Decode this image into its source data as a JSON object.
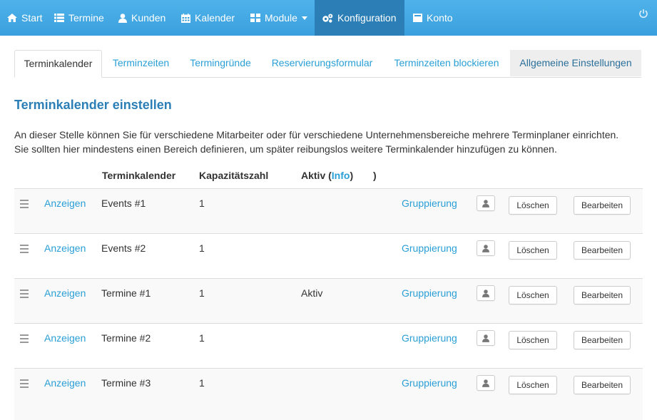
{
  "nav": {
    "items": [
      {
        "label": "Start",
        "icon": "home-icon"
      },
      {
        "label": "Termine",
        "icon": "list-icon"
      },
      {
        "label": "Kunden",
        "icon": "user-icon"
      },
      {
        "label": "Kalender",
        "icon": "calendar-icon"
      },
      {
        "label": "Module",
        "icon": "grid-icon"
      },
      {
        "label": "Konfiguration",
        "icon": "gears-icon"
      },
      {
        "label": "Konto",
        "icon": "account-icon"
      }
    ],
    "active": "Konfiguration",
    "power_icon": "power-icon"
  },
  "tabs": [
    "Terminkalender",
    "Terminzeiten",
    "Termingründe",
    "Reservierungsformular",
    "Terminzeiten blockieren",
    "Allgemeine Einstellungen"
  ],
  "active_tab": "Terminkalender",
  "page": {
    "title": "Terminkalender einstellen",
    "desc_line1": "An dieser Stelle können Sie für verschiedene Mitarbeiter oder für verschiedene Unternehmensbereiche mehrere Terminplaner einrichten.",
    "desc_line2": "Sie sollten hier mindestens einen Bereich definieren, um später reibungslos weitere Terminkalender hinzufügen zu können."
  },
  "table": {
    "headers": {
      "calendar": "Terminkalender",
      "capacity": "Kapazitätszahl",
      "active_prefix": "Aktiv (",
      "active_info": "Info",
      "active_suffix": ")",
      "extra": ")"
    },
    "show_label": "Anzeigen",
    "group_label": "Gruppierung",
    "delete_label": "Löschen",
    "edit_label": "Bearbeiten",
    "rows": [
      {
        "name": "Events #1",
        "capacity": "1",
        "active": ""
      },
      {
        "name": "Events #2",
        "capacity": "1",
        "active": ""
      },
      {
        "name": "Termine #1",
        "capacity": "1",
        "active": "Aktiv"
      },
      {
        "name": "Termine #2",
        "capacity": "1",
        "active": ""
      },
      {
        "name": "Termine #3",
        "capacity": "1",
        "active": ""
      }
    ]
  },
  "colors": {
    "nav": "#3aa0dd",
    "nav_active": "#2b7fb6",
    "link": "#2a9fd6",
    "title": "#2b7fb6"
  }
}
